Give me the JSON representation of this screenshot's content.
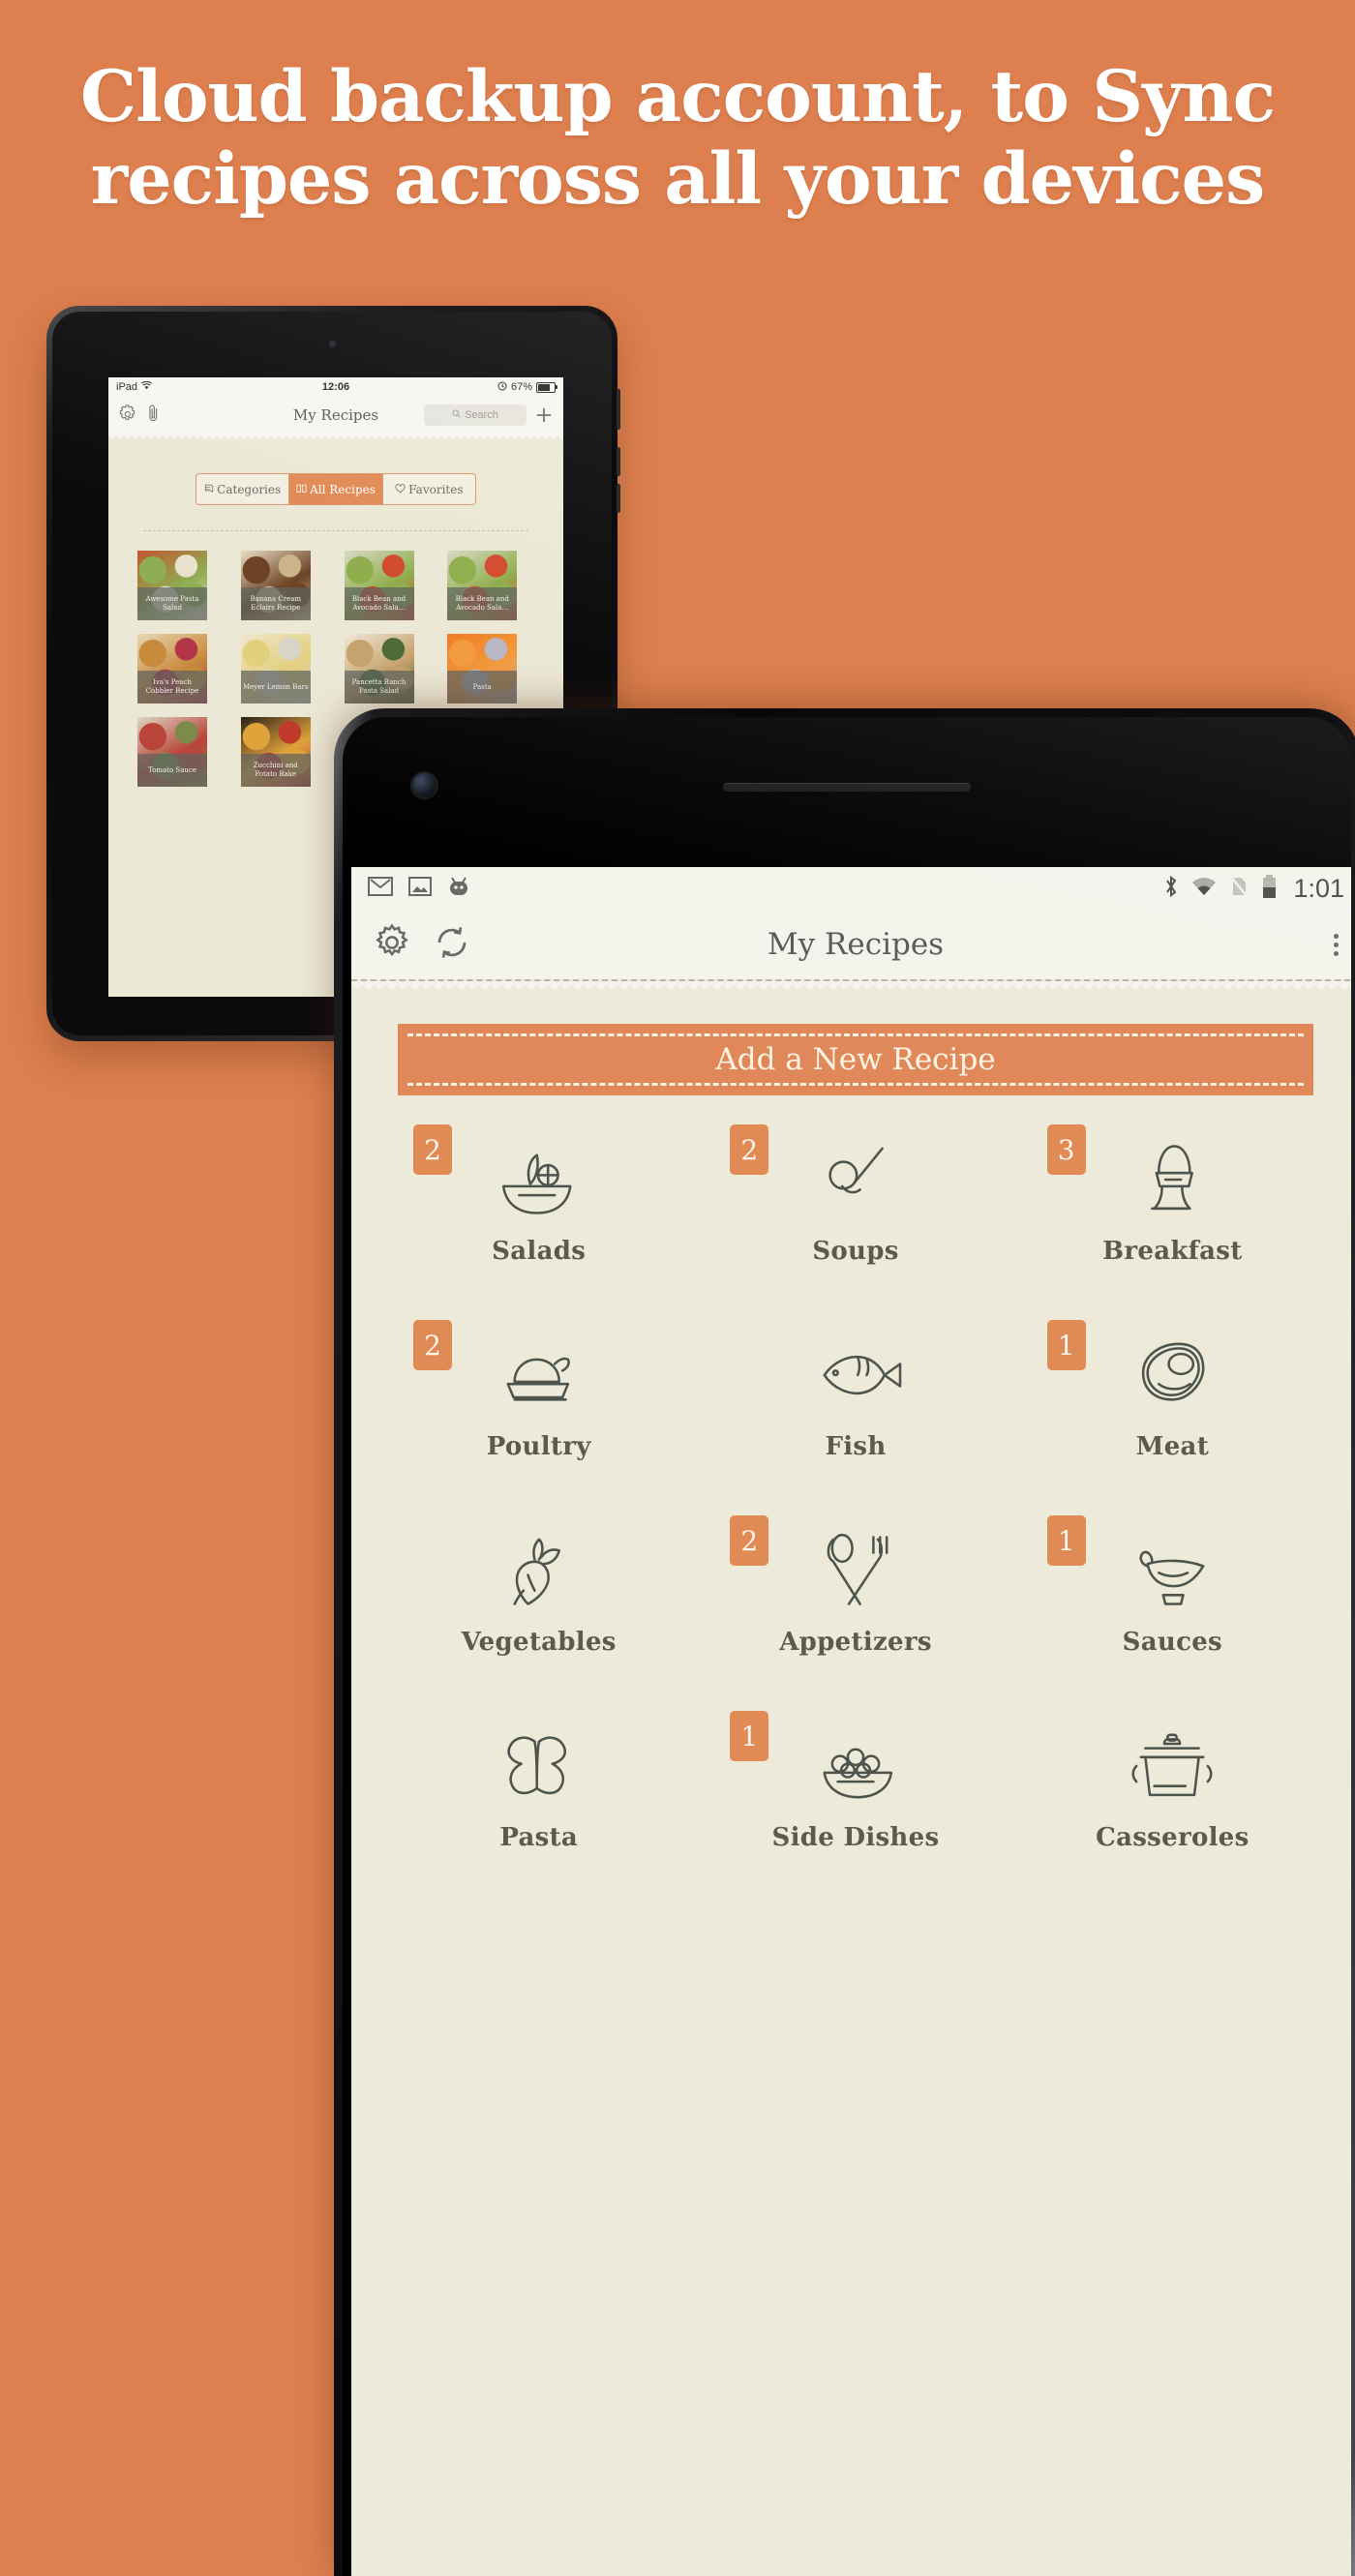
{
  "page": {
    "background_color": "#dd7f4e",
    "headline": "Cloud backup account, to Sync recipes across all your devices"
  },
  "ipad": {
    "status_bar": {
      "device": "iPad",
      "wifi_icon": "wifi-icon",
      "time": "12:06",
      "lock_icon": "rotation-lock-icon",
      "battery_percent": "67%",
      "battery_icon": "battery-icon"
    },
    "nav": {
      "settings_icon": "gear-icon",
      "attachment_icon": "paperclip-icon",
      "title": "My Recipes",
      "search_placeholder": "Search",
      "search_icon": "search-icon",
      "add_icon": "plus-icon"
    },
    "segments": [
      {
        "label": "Categories",
        "icon": "book-stack-icon",
        "active": false
      },
      {
        "label": "All Recipes",
        "icon": "open-book-icon",
        "active": true
      },
      {
        "label": "Favorites",
        "icon": "heart-icon",
        "active": false
      }
    ],
    "recipes": [
      {
        "title": "Awesome Pasta Salad",
        "c1": "#c0562f",
        "c2": "#8fae54",
        "c3": "#e8e1cc"
      },
      {
        "title": "Banana Cream Eclairs Recipe",
        "c1": "#e9ddc4",
        "c2": "#6c4325",
        "c3": "#cbb48a"
      },
      {
        "title": "Black Bean and Avocado Sala…",
        "c1": "#d8d9c6",
        "c2": "#8fae4c",
        "c3": "#d24b2e"
      },
      {
        "title": "Black Bean and Avocado Sala…",
        "c1": "#d8d9c6",
        "c2": "#8fae4c",
        "c3": "#d24b2e"
      },
      {
        "title": "Iva's Peach Cobbler Recipe",
        "c1": "#e8d7b2",
        "c2": "#c98a3e",
        "c3": "#b33548"
      },
      {
        "title": "Meyer Lemon Bars",
        "c1": "#efe7cd",
        "c2": "#e3d07f",
        "c3": "#d7d4c8"
      },
      {
        "title": "Pancetta Ranch Pasta Salad",
        "c1": "#efe8d6",
        "c2": "#c6a36e",
        "c3": "#4d6b35"
      },
      {
        "title": "Pasta",
        "c1": "#f07c23",
        "c2": "#f29b3f",
        "c3": "#b9b6c6"
      },
      {
        "title": "Tomato Sauce",
        "c1": "#ddd7c4",
        "c2": "#b8443a",
        "c3": "#7d8b4a"
      },
      {
        "title": "Zucchini and Potato Bake",
        "c1": "#2b2118",
        "c2": "#e0a33c",
        "c3": "#c03a2b"
      }
    ]
  },
  "phone": {
    "status_bar": {
      "notification_icons": [
        "gmail-icon",
        "image-icon",
        "android-icon"
      ],
      "system_icons": [
        "bluetooth-icon",
        "wifi-icon",
        "no-sim-icon",
        "battery-icon"
      ],
      "time": "1:01"
    },
    "header": {
      "settings_icon": "gear-icon",
      "sync_icon": "sync-icon",
      "title": "My Recipes",
      "overflow_icon": "overflow-menu-icon"
    },
    "add_button": {
      "label": "Add a New Recipe"
    },
    "categories": [
      {
        "label": "Salads",
        "count": "2",
        "icon": "salad-bowl-icon"
      },
      {
        "label": "Soups",
        "count": "2",
        "icon": "ladle-icon"
      },
      {
        "label": "Breakfast",
        "count": "3",
        "icon": "egg-cup-icon"
      },
      {
        "label": "Poultry",
        "count": "2",
        "icon": "roast-chicken-icon"
      },
      {
        "label": "Fish",
        "count": "",
        "icon": "fish-icon"
      },
      {
        "label": "Meat",
        "count": "1",
        "icon": "steak-icon"
      },
      {
        "label": "Vegetables",
        "count": "",
        "icon": "beetroot-icon"
      },
      {
        "label": "Appetizers",
        "count": "2",
        "icon": "fork-spoon-icon"
      },
      {
        "label": "Sauces",
        "count": "1",
        "icon": "gravy-boat-icon"
      },
      {
        "label": "Pasta",
        "count": "",
        "icon": "farfalle-icon"
      },
      {
        "label": "Side Dishes",
        "count": "1",
        "icon": "bowl-of-peas-icon"
      },
      {
        "label": "Casseroles",
        "count": "",
        "icon": "casserole-pot-icon"
      }
    ]
  },
  "colors": {
    "accent": "#dd7f4e",
    "button": "#e0885a",
    "cream": "#edead9",
    "ink": "#5e584e"
  }
}
